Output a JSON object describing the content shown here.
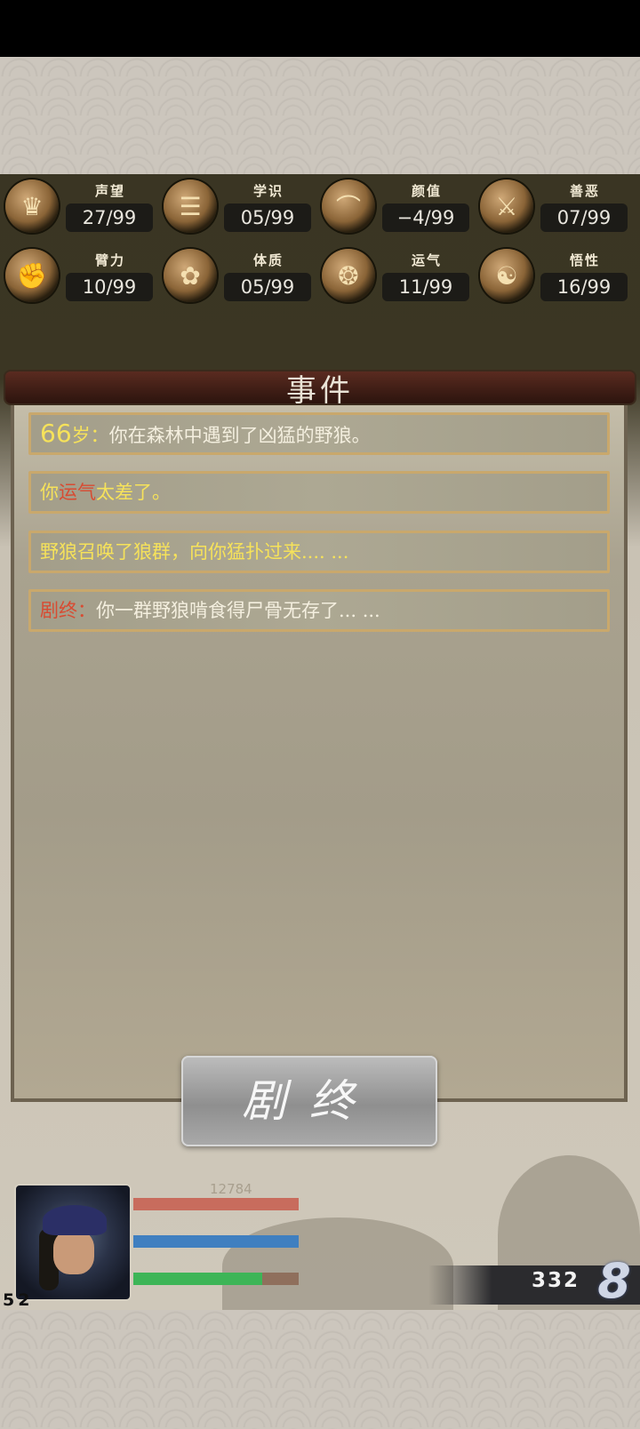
{
  "stats": [
    {
      "label": "声望",
      "value": "27/99",
      "icon": "prestige-icon"
    },
    {
      "label": "学识",
      "value": "05/99",
      "icon": "scroll-icon"
    },
    {
      "label": "颜值",
      "value": "−4/99",
      "icon": "hat-icon"
    },
    {
      "label": "善恶",
      "value": "07/99",
      "icon": "crossed-blades-icon"
    },
    {
      "label": "臂力",
      "value": "10/99",
      "icon": "strength-icon"
    },
    {
      "label": "体质",
      "value": "05/99",
      "icon": "constitution-icon"
    },
    {
      "label": "运气",
      "value": "11/99",
      "icon": "luck-icon"
    },
    {
      "label": "悟性",
      "value": "16/99",
      "icon": "insight-icon"
    }
  ],
  "panel": {
    "title": "事件"
  },
  "events": {
    "e1": {
      "age": "66",
      "age_suffix": "岁：",
      "text": "你在森林中遇到了凶猛的野狼。"
    },
    "e2": {
      "prefix": "你",
      "highlight": "运气",
      "suffix": "太差了。"
    },
    "e3": {
      "text": "野狼召唤了狼群，向你猛扑过来.... ..."
    },
    "e4": {
      "prefix": "剧终：",
      "text": "你一群野狼啃食得尸骨无存了... ..."
    }
  },
  "end_button": {
    "label": "剧终"
  },
  "player": {
    "level": "52",
    "hp_value": "12784",
    "hp_fill": 1.0,
    "mp_fill": 1.0,
    "exp_fill": 0.78
  },
  "currency": {
    "amount": "332",
    "icon": "currency-icon"
  }
}
